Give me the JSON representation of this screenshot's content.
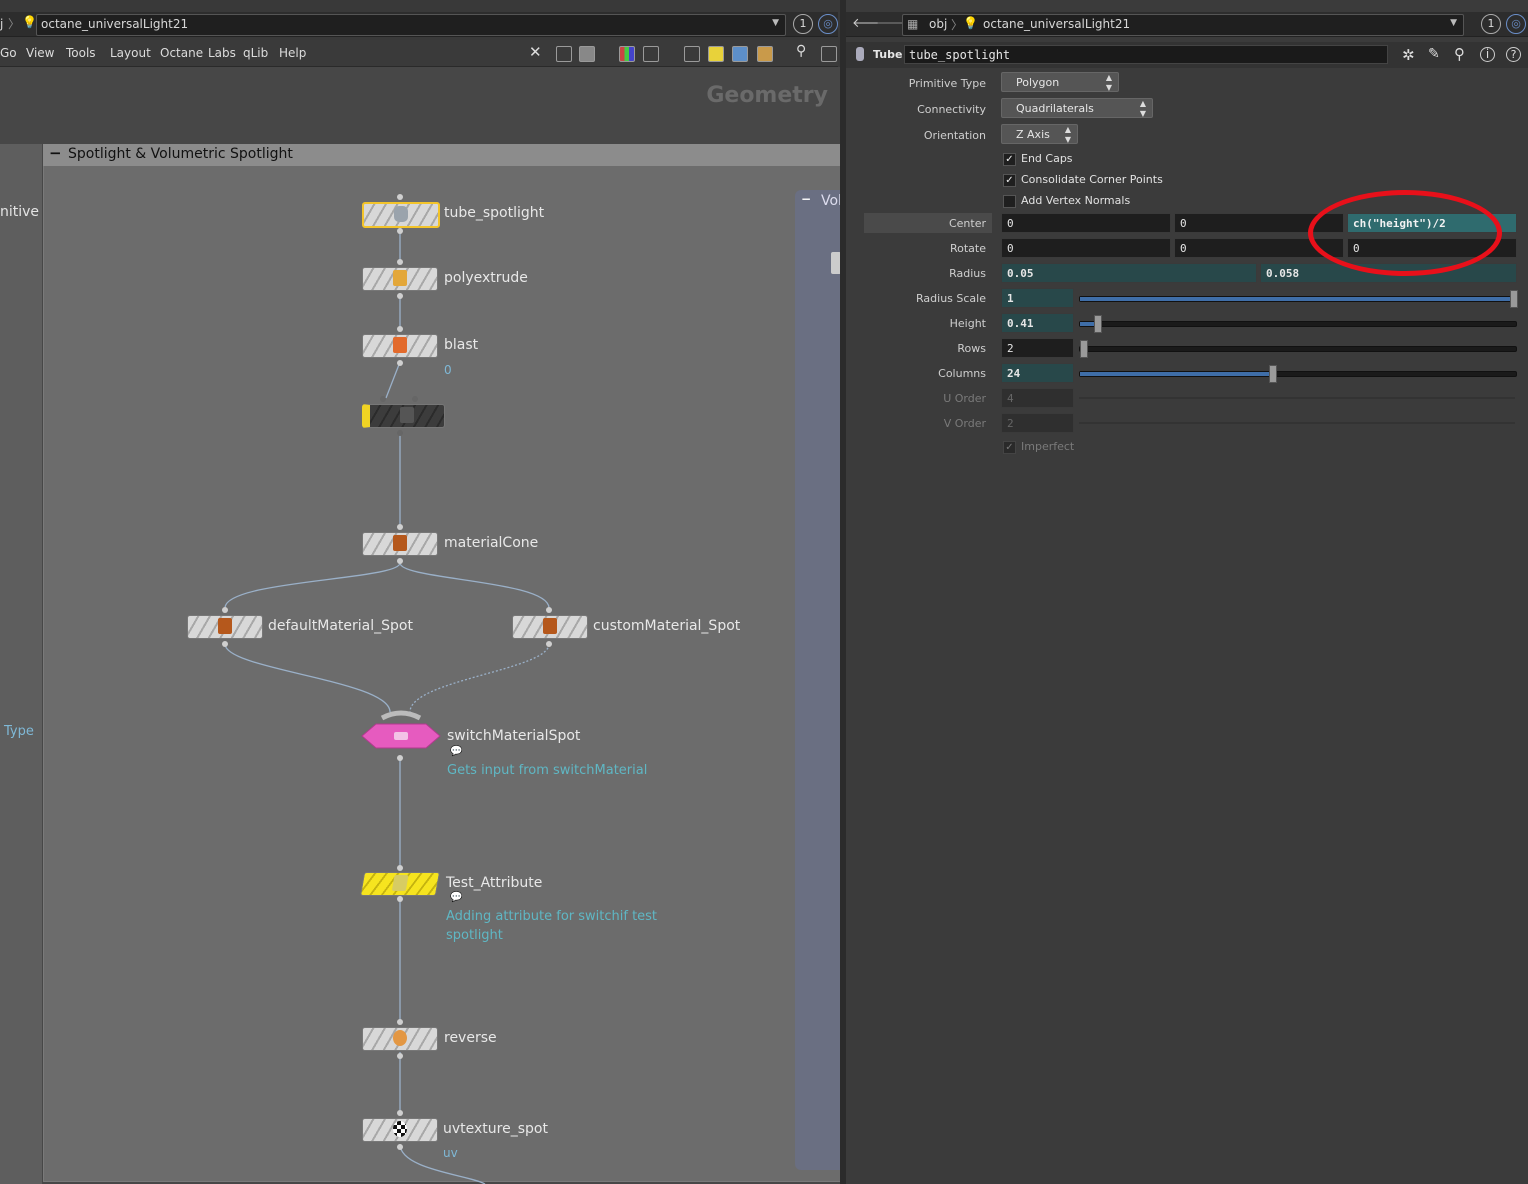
{
  "left": {
    "path": {
      "prefix": "j",
      "node": "octane_universalLight21",
      "badge": "1"
    },
    "menu": [
      "Go",
      "View",
      "Tools",
      "Layout",
      "Octane",
      "Labs",
      "qLib",
      "Help"
    ],
    "context_label": "Geometry",
    "side_box": {
      "text_1": "nitive",
      "text_2": "Type"
    },
    "network_box": {
      "title": "Spotlight & Volumetric Spotlight",
      "right_title": "Vol"
    },
    "nodes": {
      "tube": "tube_spotlight",
      "polyextrude": "polyextrude",
      "blast": "blast",
      "blast_sub": "0",
      "material_cone": "materialCone",
      "default_mat": "defaultMaterial_Spot",
      "custom_mat": "customMaterial_Spot",
      "switch": "switchMaterialSpot",
      "switch_note": "Gets input from switchMaterial",
      "test_attr": "Test_Attribute",
      "test_attr_note_1": "Adding attribute for switchif test",
      "test_attr_note_2": "spotlight",
      "reverse": "reverse",
      "uvtexture": "uvtexture_spot",
      "uvtexture_sub": "uv"
    }
  },
  "right": {
    "path": {
      "context": "obj",
      "node": "octane_universalLight21",
      "badge": "1"
    },
    "header": {
      "type_label": "Tube",
      "node_name": "tube_spotlight"
    },
    "params": {
      "primitive_type": {
        "label": "Primitive Type",
        "value": "Polygon"
      },
      "connectivity": {
        "label": "Connectivity",
        "value": "Quadrilaterals"
      },
      "orientation": {
        "label": "Orientation",
        "value": "Z Axis"
      },
      "end_caps": {
        "label": "End Caps",
        "checked": true
      },
      "consolidate": {
        "label": "Consolidate Corner Points",
        "checked": true
      },
      "add_vertex_normals": {
        "label": "Add Vertex Normals",
        "checked": false
      },
      "center": {
        "label": "Center",
        "x": "0",
        "y": "0",
        "z": "ch(\"height\")/2"
      },
      "rotate": {
        "label": "Rotate",
        "x": "0",
        "y": "0",
        "z": "0"
      },
      "radius": {
        "label": "Radius",
        "a": "0.05",
        "b": "0.058"
      },
      "radius_scale": {
        "label": "Radius Scale",
        "value": "1",
        "slider_fraction": 1.0
      },
      "height": {
        "label": "Height",
        "value": "0.41",
        "slider_fraction": 0.04
      },
      "rows": {
        "label": "Rows",
        "value": "2",
        "slider_fraction": 0.0
      },
      "columns": {
        "label": "Columns",
        "value": "24",
        "slider_fraction": 0.44
      },
      "u_order": {
        "label": "U Order",
        "value": "4"
      },
      "v_order": {
        "label": "V Order",
        "value": "2"
      },
      "imperfect": {
        "label": "Imperfect",
        "checked": true
      }
    }
  },
  "colors": {
    "highlight_ring": "#e8101a",
    "teal_field": "#2f6b6e",
    "switch_node": "#e65bbf",
    "test_attr_node": "#f2e21a",
    "note_text": "#7fb8d6"
  }
}
